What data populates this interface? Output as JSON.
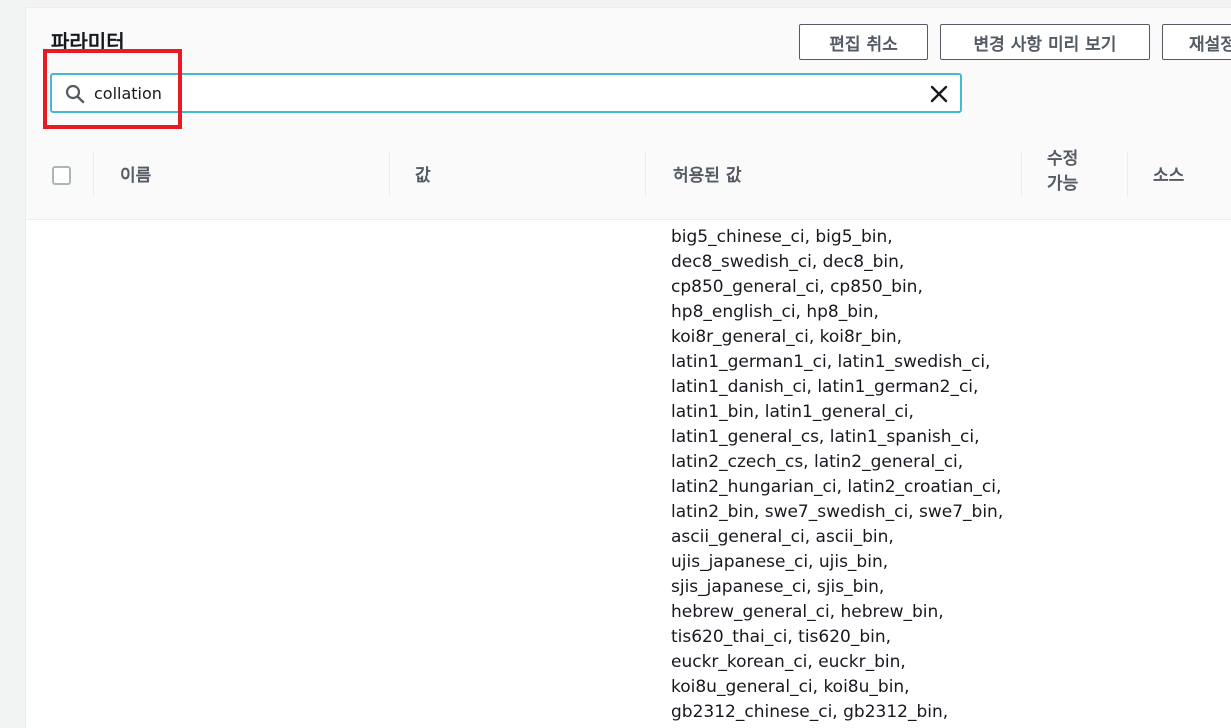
{
  "panel": {
    "title": "파라미터",
    "buttons": {
      "cancel_edit": "편집 취소",
      "preview_changes": "변경 사항 미리 보기",
      "reset": "재설정"
    }
  },
  "search": {
    "value": "collation"
  },
  "table": {
    "columns": {
      "name": "이름",
      "value": "값",
      "allowed_values": "허용된 값",
      "editable": "수정\n가능",
      "source": "소스"
    },
    "rows": [
      {
        "allowed_values_lines": [
          "big5_chinese_ci, big5_bin,",
          "dec8_swedish_ci, dec8_bin,",
          "cp850_general_ci, cp850_bin,",
          "hp8_english_ci, hp8_bin,",
          "koi8r_general_ci, koi8r_bin,",
          "latin1_german1_ci, latin1_swedish_ci,",
          "latin1_danish_ci, latin1_german2_ci,",
          "latin1_bin, latin1_general_ci,",
          "latin1_general_cs, latin1_spanish_ci,",
          "latin2_czech_cs, latin2_general_ci,",
          "latin2_hungarian_ci, latin2_croatian_ci,",
          "latin2_bin, swe7_swedish_ci, swe7_bin,",
          "ascii_general_ci, ascii_bin,",
          "ujis_japanese_ci, ujis_bin,",
          "sjis_japanese_ci, sjis_bin,",
          "hebrew_general_ci, hebrew_bin,",
          "tis620_thai_ci, tis620_bin,",
          "euckr_korean_ci, euckr_bin,",
          "koi8u_general_ci, koi8u_bin,",
          "gb2312_chinese_ci, gb2312_bin,"
        ]
      }
    ]
  },
  "colors": {
    "search_focus_border": "#44b9d6",
    "highlight_annotation": "#e81b23"
  }
}
